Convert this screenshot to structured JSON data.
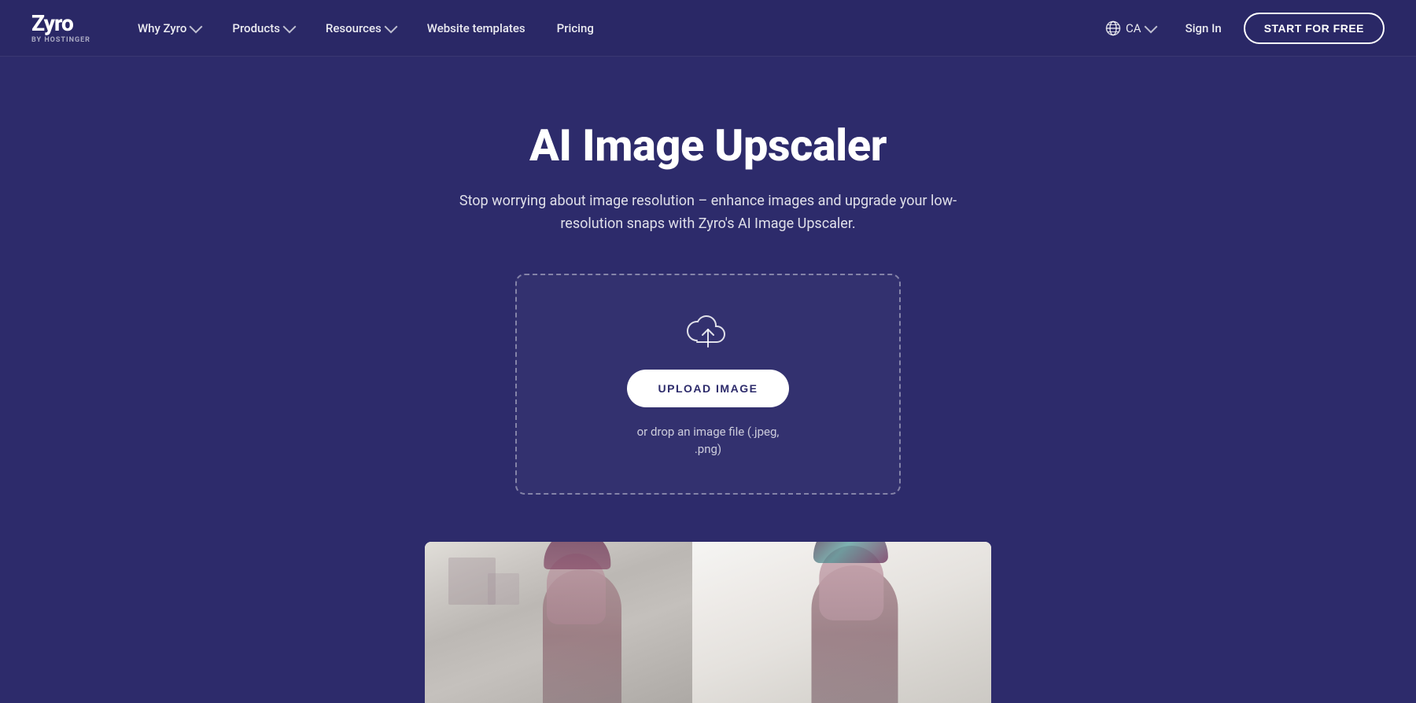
{
  "logo": {
    "name": "Zyro",
    "sub_prefix": "BY",
    "sub_brand": "HOSTINGER"
  },
  "nav": {
    "items": [
      {
        "label": "Why Zyro",
        "has_dropdown": true
      },
      {
        "label": "Products",
        "has_dropdown": true
      },
      {
        "label": "Resources",
        "has_dropdown": true
      },
      {
        "label": "Website templates",
        "has_dropdown": false
      },
      {
        "label": "Pricing",
        "has_dropdown": false
      }
    ],
    "locale": "CA",
    "signin_label": "Sign In",
    "cta_label": "START FOR FREE"
  },
  "hero": {
    "title": "AI Image Upscaler",
    "subtitle": "Stop worrying about image resolution – enhance images and upgrade your low-resolution snaps with Zyro's AI Image Upscaler.",
    "upload_button": "UPLOAD IMAGE",
    "drop_hint_line1": "or drop an image file (.jpeg,",
    "drop_hint_line2": ".png)"
  },
  "colors": {
    "bg_dark": "#2d2b6b",
    "nav_bg": "#2a2866",
    "white": "#ffffff",
    "btn_text": "#2d2b6b"
  }
}
